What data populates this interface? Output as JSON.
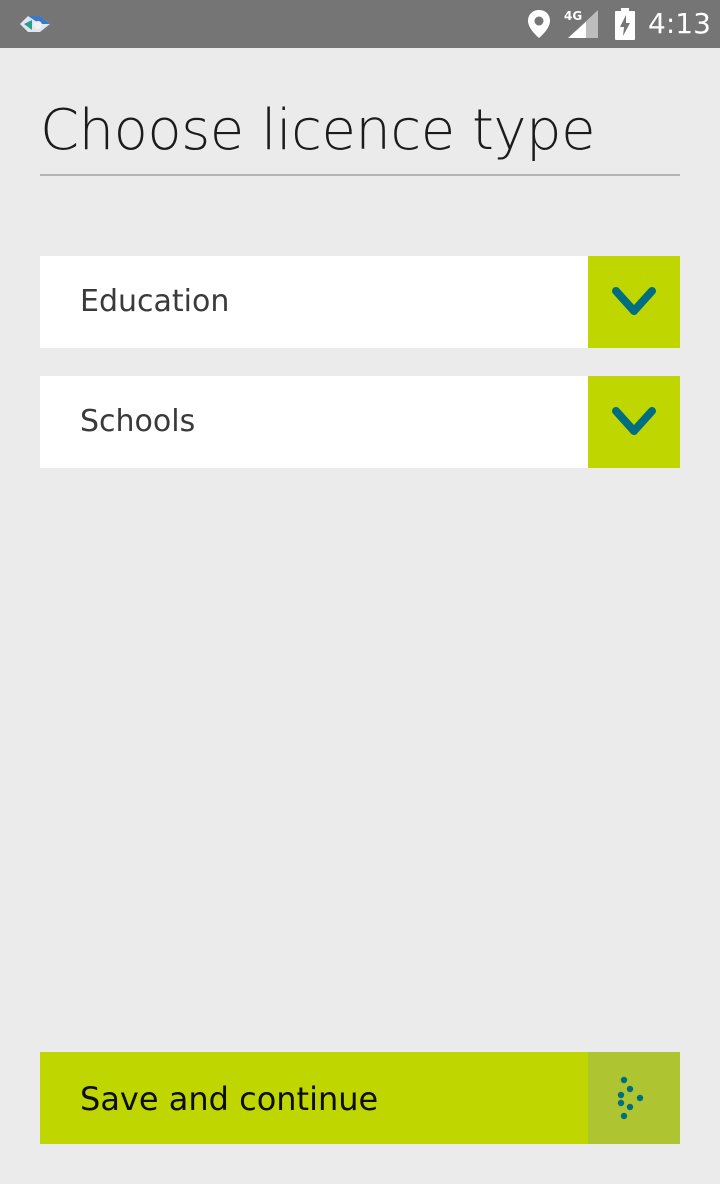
{
  "status_bar": {
    "time": "4:13",
    "network_label": "4G",
    "icons": [
      "app-launcher-icon",
      "location-icon",
      "signal-icon",
      "battery-charging-icon"
    ]
  },
  "page": {
    "title": "Choose licence type"
  },
  "dropdowns": [
    {
      "selected": "Education",
      "icon": "chevron-down-icon"
    },
    {
      "selected": "Schools",
      "icon": "chevron-down-icon"
    }
  ],
  "save_button": {
    "label": "Save and continue",
    "icon": "dotted-arrow-icon"
  },
  "colors": {
    "status_bar": "#757575",
    "background": "#ebebeb",
    "accent": "#bfd600",
    "accent_dark": "#aec431",
    "icon_teal": "#006e7f"
  }
}
